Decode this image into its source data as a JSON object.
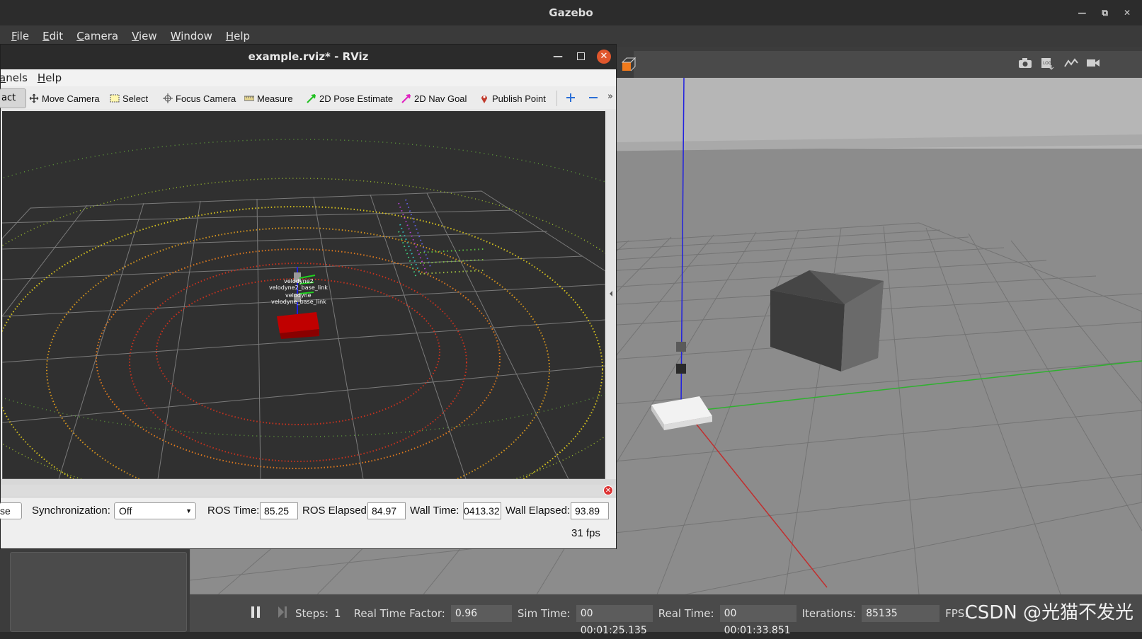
{
  "gazebo": {
    "title": "Gazebo",
    "menu": [
      "File",
      "Edit",
      "Camera",
      "View",
      "Window",
      "Help"
    ],
    "bottom": {
      "steps_label": "Steps:",
      "steps_value": "1",
      "rtf_label": "Real Time Factor:",
      "rtf_value": "0.96",
      "sim_time_label": "Sim Time:",
      "sim_time_value": "00 00:01:25.135",
      "real_time_label": "Real Time:",
      "real_time_value": "00 00:01:33.851",
      "iterations_label": "Iterations:",
      "iterations_value": "85135",
      "fps_label": "FPS:"
    },
    "watermark": "CSDN @光猫不发光",
    "toolbar_icons": [
      "camera-icon",
      "log-icon",
      "plot-icon",
      "video-icon"
    ]
  },
  "rviz": {
    "title": "example.rviz* - RViz",
    "menu": [
      "anels",
      "Help"
    ],
    "tools": {
      "interact": "act",
      "move_camera": "Move Camera",
      "select": "Select",
      "focus_camera": "Focus Camera",
      "measure": "Measure",
      "pose_estimate": "2D Pose Estimate",
      "nav_goal": "2D Nav Goal",
      "publish_point": "Publish Point",
      "more": "»"
    },
    "tf_labels": [
      "velodyne2",
      "velodyne2_base_link",
      "velodyne",
      "velodyne_base_link"
    ],
    "time": {
      "pause_label": "se",
      "sync_label": "Synchronization:",
      "sync_value": "Off",
      "ros_time_label": "ROS Time:",
      "ros_time_value": "85.25",
      "ros_elapsed_label": "ROS Elapsed:",
      "ros_elapsed_value": "84.97",
      "wall_time_label": "Wall Time:",
      "wall_time_value": "0413.32",
      "wall_elapsed_label": "Wall Elapsed:",
      "wall_elapsed_value": "93.89",
      "fps": "31 fps"
    }
  },
  "colors": {
    "rviz_bg": "#303030",
    "gazebo_ground": "#8a8a8a",
    "ring_red": "#c8321e",
    "ring_orange": "#e07a1e",
    "ring_yellow": "#d6c21e",
    "ring_green": "#9dbf2e",
    "robot_base": "#c00000"
  }
}
